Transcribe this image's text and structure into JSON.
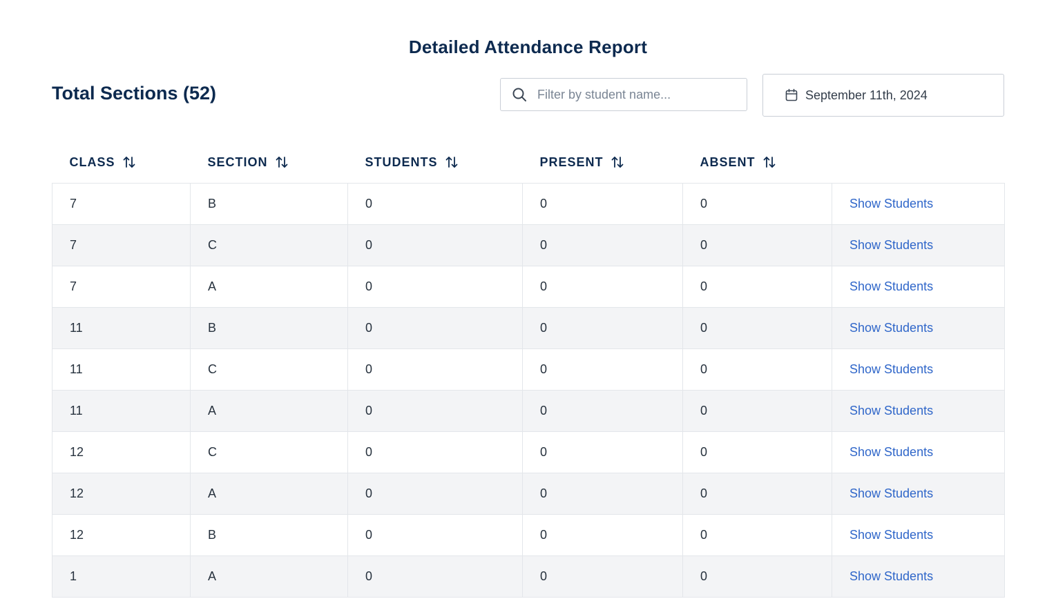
{
  "header": {
    "title": "Detailed Attendance Report"
  },
  "summary": {
    "total_label": "Total Sections (52)"
  },
  "filter": {
    "placeholder": "Filter by student name...",
    "value": ""
  },
  "date_picker": {
    "label": "September 11th, 2024"
  },
  "table": {
    "columns": [
      "CLASS",
      "SECTION",
      "STUDENTS",
      "PRESENT",
      "ABSENT",
      ""
    ],
    "action_label": "Show Students",
    "rows": [
      {
        "class": "7",
        "section": "B",
        "students": "0",
        "present": "0",
        "absent": "0",
        "action": "Show Students"
      },
      {
        "class": "7",
        "section": "C",
        "students": "0",
        "present": "0",
        "absent": "0",
        "action": "Show Students"
      },
      {
        "class": "7",
        "section": "A",
        "students": "0",
        "present": "0",
        "absent": "0",
        "action": "Show Students"
      },
      {
        "class": "11",
        "section": "B",
        "students": "0",
        "present": "0",
        "absent": "0",
        "action": "Show Students"
      },
      {
        "class": "11",
        "section": "C",
        "students": "0",
        "present": "0",
        "absent": "0",
        "action": "Show Students"
      },
      {
        "class": "11",
        "section": "A",
        "students": "0",
        "present": "0",
        "absent": "0",
        "action": "Show Students"
      },
      {
        "class": "12",
        "section": "C",
        "students": "0",
        "present": "0",
        "absent": "0",
        "action": "Show Students"
      },
      {
        "class": "12",
        "section": "A",
        "students": "0",
        "present": "0",
        "absent": "0",
        "action": "Show Students"
      },
      {
        "class": "12",
        "section": "B",
        "students": "0",
        "present": "0",
        "absent": "0",
        "action": "Show Students"
      },
      {
        "class": "1",
        "section": "A",
        "students": "0",
        "present": "0",
        "absent": "0",
        "action": "Show Students"
      }
    ]
  },
  "icons": {
    "search": "search-icon",
    "calendar": "calendar-icon",
    "sort": "sort-icon"
  },
  "colors": {
    "heading": "#0d2a4f",
    "link": "#2f66c9",
    "stripe": "#f3f4f6"
  }
}
